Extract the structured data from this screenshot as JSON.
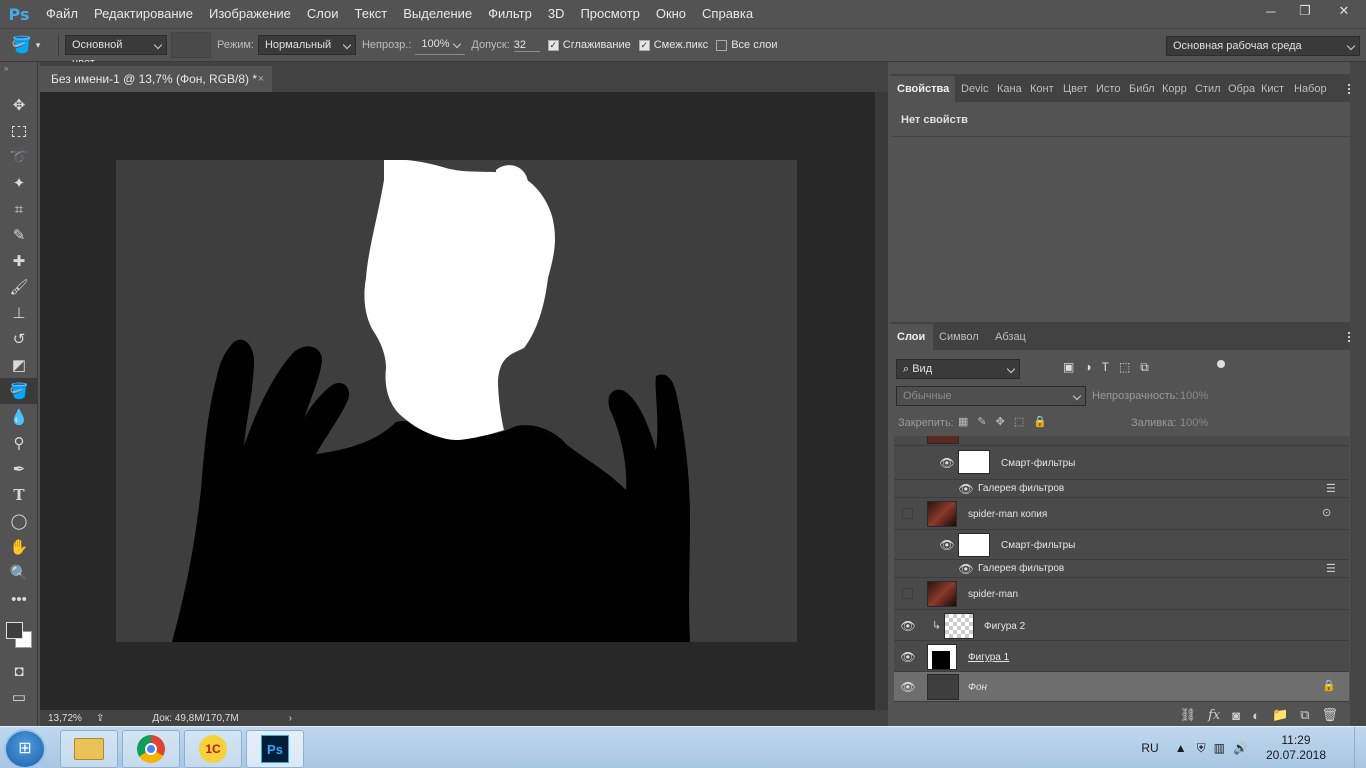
{
  "app": {
    "logo": "Ps"
  },
  "menu": [
    "Файл",
    "Редактирование",
    "Изображение",
    "Слои",
    "Текст",
    "Выделение",
    "Фильтр",
    "3D",
    "Просмотр",
    "Окно",
    "Справка"
  ],
  "options": {
    "fill_source": "Основной цвет",
    "mode_label": "Режим:",
    "mode_value": "Нормальный",
    "opacity_label": "Непрозр.:",
    "opacity_value": "100%",
    "tolerance_label": "Допуск:",
    "tolerance_value": "32",
    "antialias_label": "Сглаживание",
    "contiguous_label": "Смеж.пикс",
    "all_layers_label": "Все слои",
    "workspace": "Основная рабочая среда"
  },
  "document": {
    "tab_title": "Без имени-1 @ 13,7% (Фон, RGB/8) *",
    "close": "×",
    "zoom": "13,72%",
    "doc_info": "Док: 49,8M/170,7M"
  },
  "properties_panel": {
    "tabs": [
      "Свойства",
      "Devic",
      "Кана",
      "Конт",
      "Цвет",
      "Исто",
      "Библ",
      "Корр",
      "Стил",
      "Обра",
      "Кист",
      "Набор"
    ],
    "no_properties": "Нет свойств"
  },
  "layers_panel": {
    "tabs": [
      "Слои",
      "Символ",
      "Абзац"
    ],
    "filter_kind": "Вид",
    "blend_mode": "Обычные",
    "opacity_label": "Непрозрачность:",
    "opacity_value": "100%",
    "lock_label": "Закрепить:",
    "fill_label": "Заливка:",
    "fill_value": "100%",
    "smart_filters": "Смарт-фильтры",
    "filter_gallery": "Галерея фильтров",
    "layers": [
      {
        "name": "spider-man копия",
        "visible": false
      },
      {
        "name": "spider-man",
        "visible": false
      },
      {
        "name": "Фигура 2",
        "visible": true
      },
      {
        "name": "Фигура 1",
        "visible": true
      },
      {
        "name": "Фон",
        "visible": true
      }
    ]
  },
  "taskbar": {
    "apps": [
      "explorer",
      "chrome",
      "1c",
      "photoshop"
    ],
    "lang": "RU",
    "time": "11:29",
    "date": "20.07.2018"
  },
  "colors": {
    "ui_bg": "#535353",
    "canvas_bg": "#3e3e3e",
    "pasteboard": "#282828",
    "ps_blue": "#4aa8e8"
  }
}
